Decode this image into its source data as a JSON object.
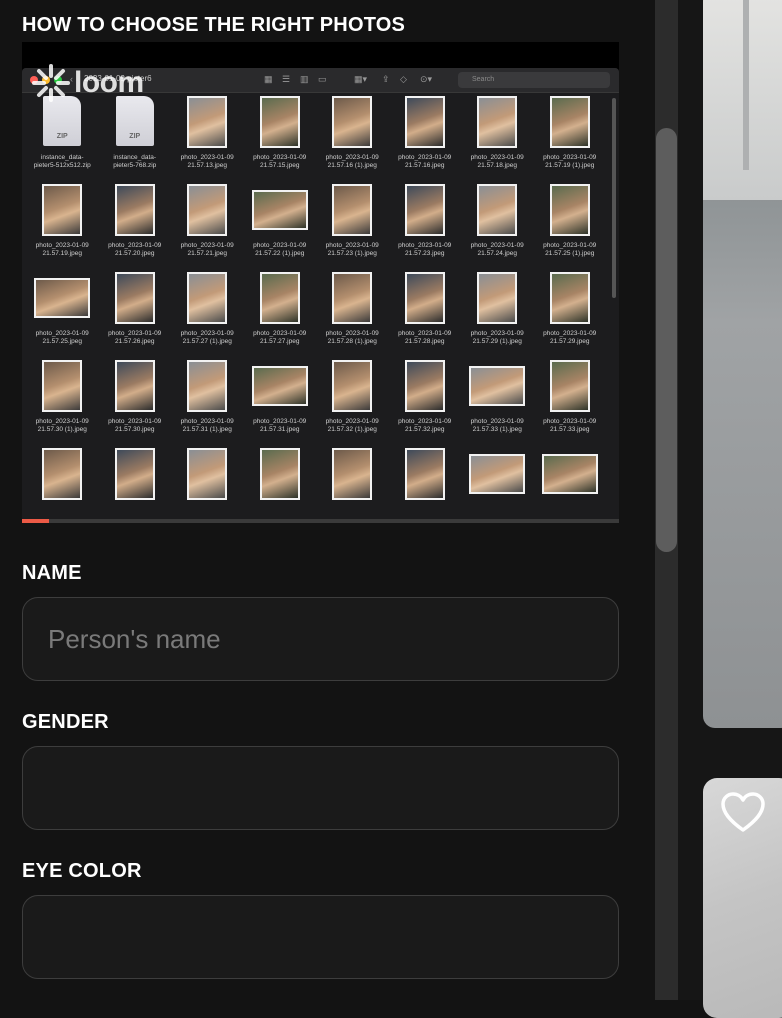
{
  "form": {
    "how_to_title": "HOW TO CHOOSE THE RIGHT PHOTOS",
    "name_label": "NAME",
    "name_placeholder": "Person's name",
    "gender_label": "GENDER",
    "gender_value": "",
    "eye_color_label": "EYE COLOR",
    "eye_color_value": ""
  },
  "video": {
    "brand": "loom",
    "progress": 0.045,
    "finder": {
      "title": "2023-01-09 pieter6",
      "search_placeholder": "Search",
      "files": [
        {
          "name": "instance_data-\npieter5-512x512.zip",
          "kind": "zip"
        },
        {
          "name": "instance_data-\npieter5-768.zip",
          "kind": "zip"
        },
        {
          "name": "photo_2023-01-09\n21.57.13.jpeg",
          "kind": "photo"
        },
        {
          "name": "photo_2023-01-09\n21.57.15.jpeg",
          "kind": "photo"
        },
        {
          "name": "photo_2023-01-09\n21.57.16 (1).jpeg",
          "kind": "photo"
        },
        {
          "name": "photo_2023-01-09\n21.57.16.jpeg",
          "kind": "photo"
        },
        {
          "name": "photo_2023-01-09\n21.57.18.jpeg",
          "kind": "photo"
        },
        {
          "name": "photo_2023-01-09\n21.57.19 (1).jpeg",
          "kind": "photo"
        },
        {
          "name": "photo_2023-01-09\n21.57.19.jpeg",
          "kind": "photo"
        },
        {
          "name": "photo_2023-01-09\n21.57.20.jpeg",
          "kind": "photo"
        },
        {
          "name": "photo_2023-01-09\n21.57.21.jpeg",
          "kind": "photo"
        },
        {
          "name": "photo_2023-01-09\n21.57.22 (1).jpeg",
          "kind": "landscape"
        },
        {
          "name": "photo_2023-01-09\n21.57.23 (1).jpeg",
          "kind": "photo"
        },
        {
          "name": "photo_2023-01-09\n21.57.23.jpeg",
          "kind": "photo"
        },
        {
          "name": "photo_2023-01-09\n21.57.24.jpeg",
          "kind": "photo"
        },
        {
          "name": "photo_2023-01-09\n21.57.25 (1).jpeg",
          "kind": "photo"
        },
        {
          "name": "photo_2023-01-09\n21.57.25.jpeg",
          "kind": "landscape"
        },
        {
          "name": "photo_2023-01-09\n21.57.26.jpeg",
          "kind": "photo"
        },
        {
          "name": "photo_2023-01-09\n21.57.27 (1).jpeg",
          "kind": "photo"
        },
        {
          "name": "photo_2023-01-09\n21.57.27.jpeg",
          "kind": "photo"
        },
        {
          "name": "photo_2023-01-09\n21.57.28 (1).jpeg",
          "kind": "photo"
        },
        {
          "name": "photo_2023-01-09\n21.57.28.jpeg",
          "kind": "photo"
        },
        {
          "name": "photo_2023-01-09\n21.57.29 (1).jpeg",
          "kind": "photo"
        },
        {
          "name": "photo_2023-01-09\n21.57.29.jpeg",
          "kind": "photo"
        },
        {
          "name": "photo_2023-01-09\n21.57.30 (1).jpeg",
          "kind": "photo"
        },
        {
          "name": "photo_2023-01-09\n21.57.30.jpeg",
          "kind": "photo"
        },
        {
          "name": "photo_2023-01-09\n21.57.31 (1).jpeg",
          "kind": "photo"
        },
        {
          "name": "photo_2023-01-09\n21.57.31.jpeg",
          "kind": "landscape"
        },
        {
          "name": "photo_2023-01-09\n21.57.32 (1).jpeg",
          "kind": "photo"
        },
        {
          "name": "photo_2023-01-09\n21.57.32.jpeg",
          "kind": "photo"
        },
        {
          "name": "photo_2023-01-09\n21.57.33 (1).jpeg",
          "kind": "landscape"
        },
        {
          "name": "photo_2023-01-09\n21.57.33.jpeg",
          "kind": "photo"
        },
        {
          "name": "",
          "kind": "photo"
        },
        {
          "name": "",
          "kind": "photo"
        },
        {
          "name": "",
          "kind": "photo"
        },
        {
          "name": "",
          "kind": "photo"
        },
        {
          "name": "",
          "kind": "photo"
        },
        {
          "name": "",
          "kind": "photo"
        },
        {
          "name": "",
          "kind": "landscape"
        },
        {
          "name": "",
          "kind": "landscape"
        }
      ]
    }
  },
  "colors": {
    "background": "#131313",
    "field_border": "#3d3d3d",
    "progress_accent": "#ec5a46",
    "scrollbar_thumb": "#5d5d5d"
  },
  "icons": {
    "loom_logo": "loom-logo-icon",
    "heart": "heart-outline-icon"
  }
}
